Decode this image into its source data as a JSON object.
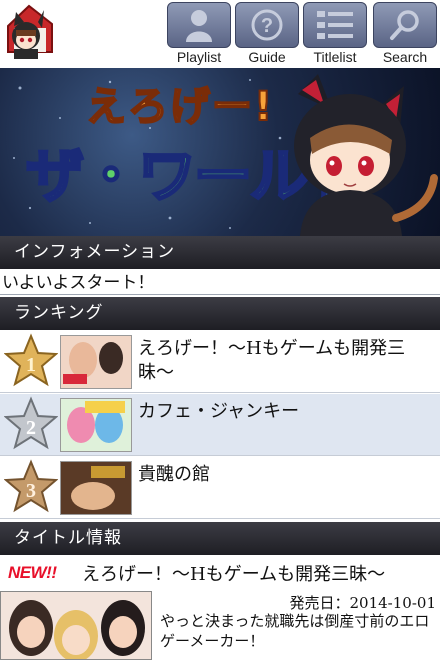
{
  "nav": {
    "items": [
      {
        "label": "Playlist",
        "icon": "person-icon"
      },
      {
        "label": "Guide",
        "icon": "question-icon"
      },
      {
        "label": "Titlelist",
        "icon": "list-icon"
      },
      {
        "label": "Search",
        "icon": "magnifier-icon"
      }
    ]
  },
  "banner": {
    "alt": ""
  },
  "info": {
    "header": "インフォメーション",
    "message": "いよいよスタート！"
  },
  "ranking": {
    "header": "ランキング",
    "items": [
      {
        "rank": "1",
        "title": "えろげー！〜Hもゲームも開発三昧〜"
      },
      {
        "rank": "2",
        "title": "カフェ・ジャンキー"
      },
      {
        "rank": "3",
        "title": "貴醜の館"
      }
    ]
  },
  "titles": {
    "header": "タイトル情報",
    "badge": "NEW!!",
    "title": "えろげー！〜Hもゲームも開発三昧〜",
    "release": "発売日：2014-10-01",
    "description": "やっと決まった就職先は倒産寸前のエロゲーメーカー！"
  },
  "colors": {
    "header_bg": "#2a2a30",
    "row_alt": "#dfe6f1",
    "new_badge": "#e8102a",
    "nav_tile": "#6c7594"
  }
}
